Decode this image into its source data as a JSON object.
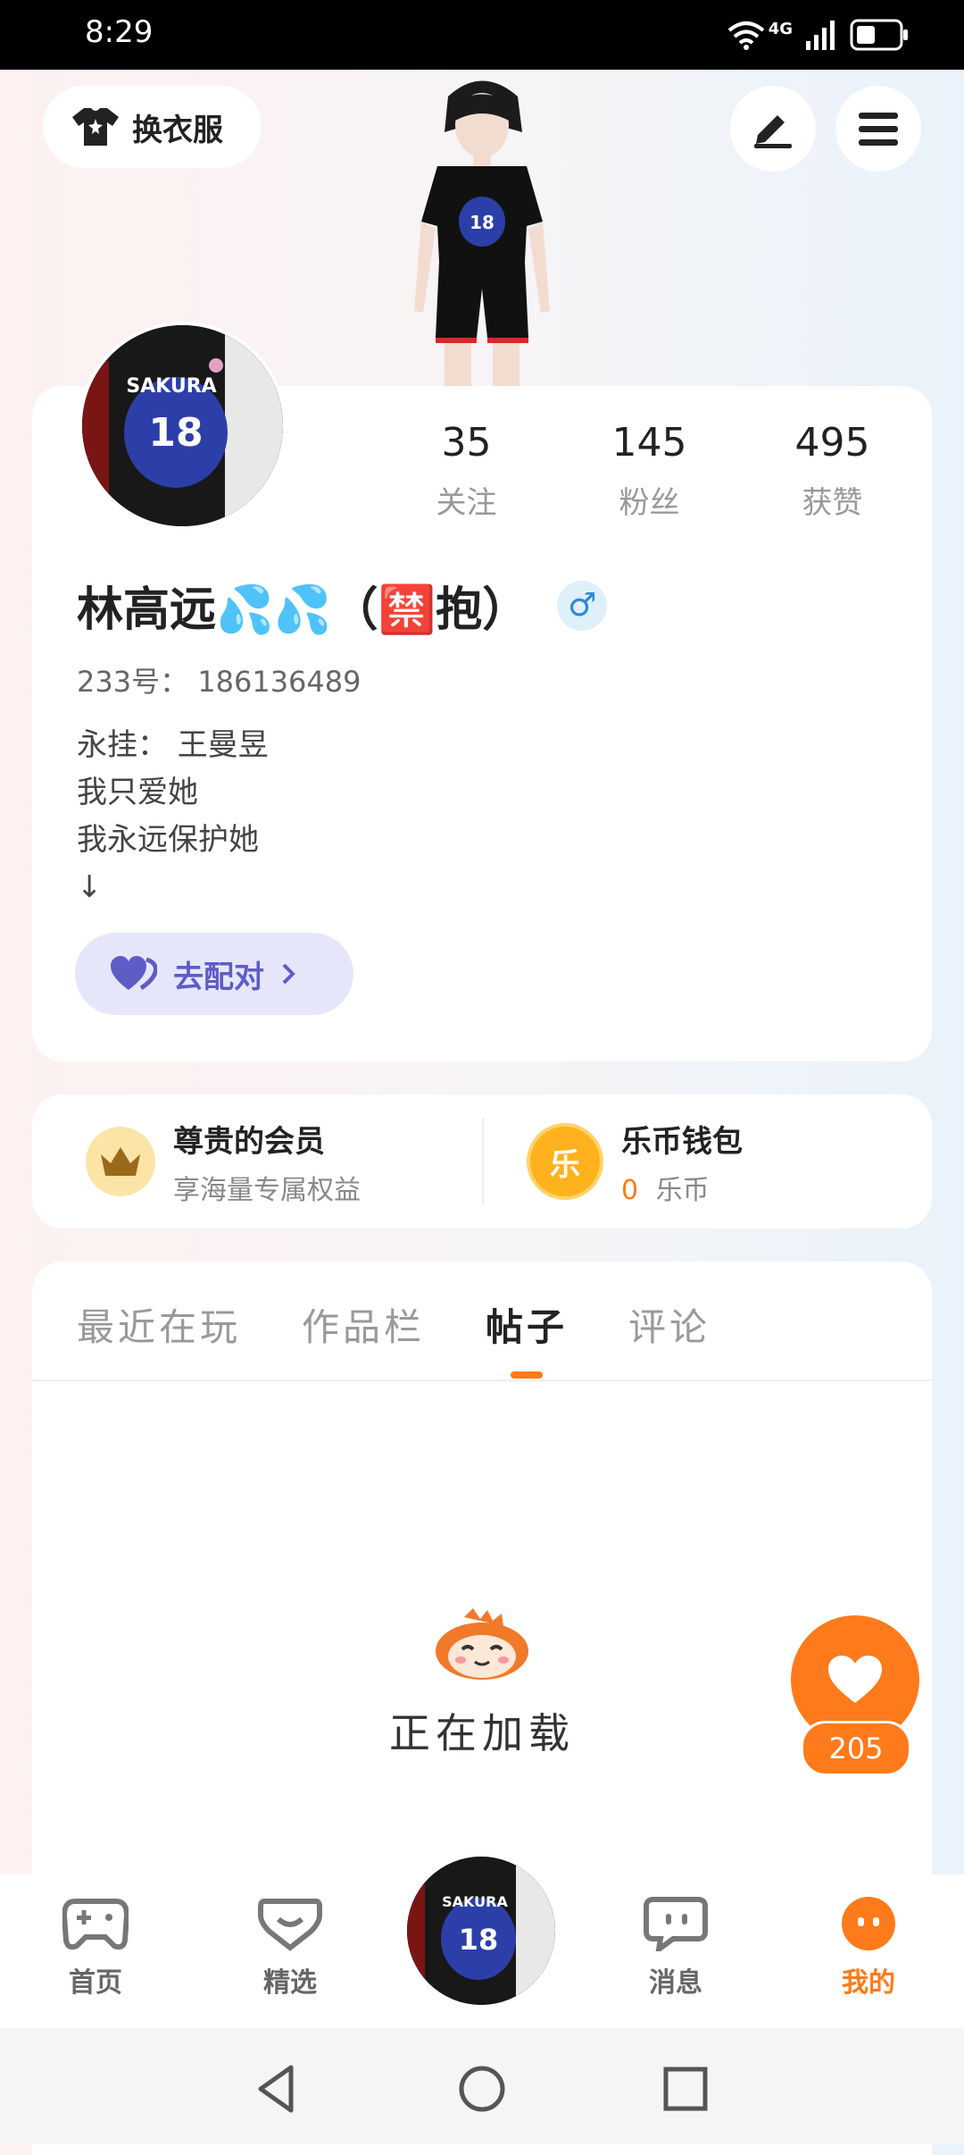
{
  "status_bar": {
    "time": "8:29",
    "network": "4G"
  },
  "header": {
    "outfit_label": "换衣服"
  },
  "profile": {
    "stats": [
      {
        "value": "35",
        "label": "关注"
      },
      {
        "value": "145",
        "label": "粉丝"
      },
      {
        "value": "495",
        "label": "获赞"
      }
    ],
    "name": "林高远💦💦（🈲抱）",
    "gender_symbol": "♂",
    "uid": "233号： 186136489",
    "bio_lines": [
      "永挂： 王曼昱",
      "我只爱她",
      "我永远保护她",
      "↓"
    ],
    "match_label": "去配对"
  },
  "vip": {
    "member_title": "尊贵的会员",
    "member_sub": "享海量专属权益",
    "wallet_title": "乐币钱包",
    "wallet_amount": "0",
    "wallet_unit": "乐币",
    "wallet_icon_char": "乐"
  },
  "tabs": [
    {
      "label": "最近在玩",
      "active": false
    },
    {
      "label": "作品栏",
      "active": false
    },
    {
      "label": "帖子",
      "active": true
    },
    {
      "label": "评论",
      "active": false
    }
  ],
  "loading_text": "正在加载",
  "like": {
    "count": "205"
  },
  "bottom_nav": [
    {
      "label": "首页",
      "icon": "gamepad-icon"
    },
    {
      "label": "精选",
      "icon": "heart-chat-icon"
    },
    {
      "label": "消息",
      "icon": "message-icon"
    },
    {
      "label": "我的",
      "icon": "profile-icon",
      "active": true
    }
  ],
  "colors": {
    "accent": "#ff7a1a",
    "match_purple": "#5e5cc7"
  }
}
